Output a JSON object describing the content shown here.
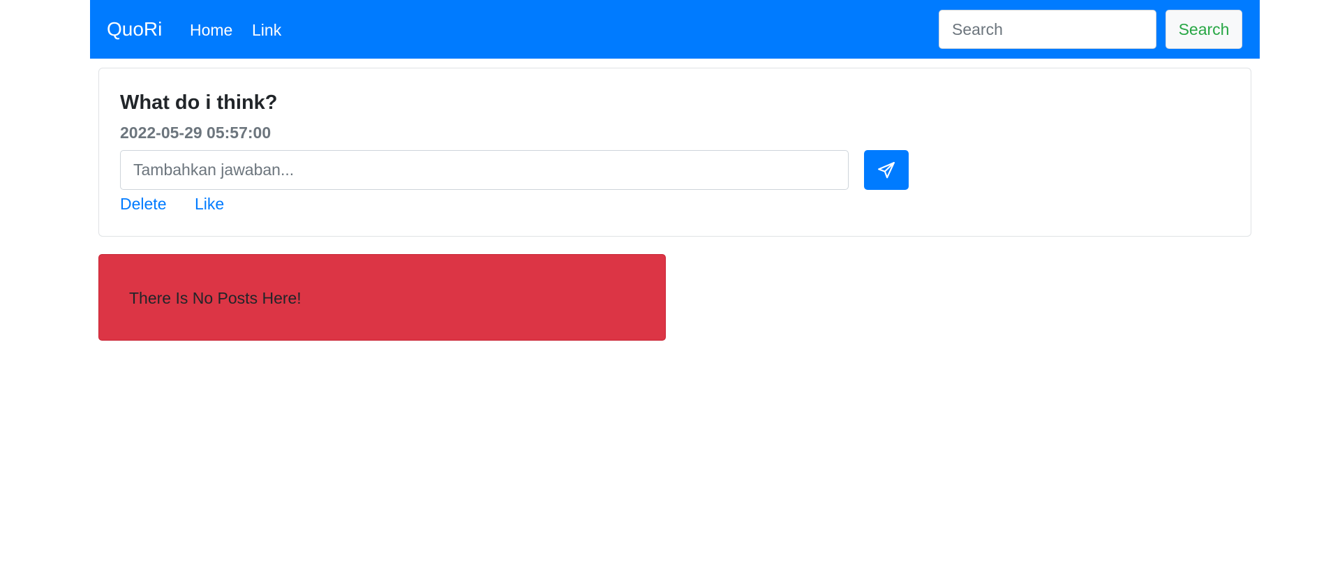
{
  "navbar": {
    "brand": "QuoRi",
    "links": [
      {
        "label": "Home"
      },
      {
        "label": "Link"
      }
    ],
    "search": {
      "placeholder": "Search",
      "value": "",
      "button_label": "Search"
    }
  },
  "question_card": {
    "title": "What do i think?",
    "timestamp": "2022-05-29 05:57:00",
    "answer_input": {
      "placeholder": "Tambahkan jawaban...",
      "value": ""
    },
    "send_button_icon": "paper-plane-icon",
    "actions": {
      "delete_label": "Delete",
      "like_label": "Like"
    }
  },
  "alert": {
    "message": "There Is No Posts Here!"
  },
  "colors": {
    "primary": "#007bff",
    "danger": "#dc3545",
    "success": "#28a745",
    "muted": "#6c757d",
    "light": "#f8f9fa"
  }
}
